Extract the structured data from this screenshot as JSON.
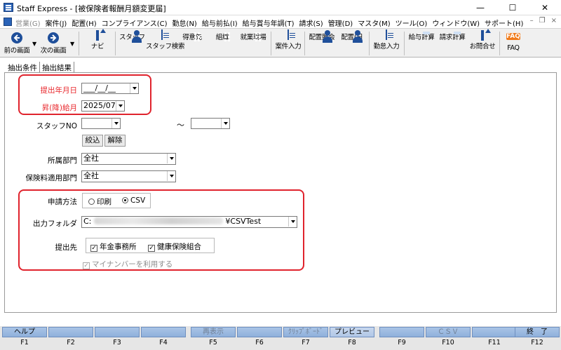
{
  "window": {
    "title": "Staff Express - [被保険者報酬月額変更届]",
    "controls": {
      "minimize": "—",
      "maximize": "☐",
      "close": "✕"
    }
  },
  "menubar": {
    "items": [
      {
        "label": "営業(G)",
        "disabled": true
      },
      {
        "label": "案件(J)"
      },
      {
        "label": "配置(H)"
      },
      {
        "label": "コンプライアンス(C)"
      },
      {
        "label": "勤怠(N)"
      },
      {
        "label": "給与前払(I)"
      },
      {
        "label": "給与賞与年調(T)"
      },
      {
        "label": "請求(S)"
      },
      {
        "label": "管理(D)"
      },
      {
        "label": "マスタ(M)"
      },
      {
        "label": "ツール(O)"
      },
      {
        "label": "ウィンドウ(W)"
      },
      {
        "label": "サポート(H)"
      }
    ],
    "mdi_controls": {
      "minimize": "–",
      "restore": "❐",
      "close": "×"
    }
  },
  "toolbar": {
    "back": "前の画面",
    "forward": "次の画面",
    "navi": "ナビ",
    "staff": "スタッフ",
    "staff_search": "スタッフ検索",
    "client": "得意先",
    "organization": "組織",
    "worksite": "就業現場",
    "case_entry": "案件入力",
    "placement_inquiry": "配置照会",
    "placement_day": "配置(日",
    "attendance_entry": "勤怠入力",
    "payroll_calc": "給与計算",
    "billing_calc": "請求計算",
    "inquiry": "お問合せ",
    "faq": "FAQ",
    "faq_icon_text": "FAQ"
  },
  "tabs": [
    "抽出条件",
    "抽出結果"
  ],
  "form": {
    "submission_date": {
      "label": "提出年月日",
      "value": "___/__/__",
      "color": "#e8252a"
    },
    "raise_month": {
      "label": "昇(降)給月",
      "value": "2025/07",
      "color": "#e8252a"
    },
    "staff_no": {
      "label": "スタッフNO",
      "from": "",
      "tilde": "～",
      "to": ""
    },
    "filter_button": "絞込",
    "clear_button": "解除",
    "department": {
      "label": "所属部門",
      "value": "全社"
    },
    "insurance_department": {
      "label": "保険料適用部門",
      "value": "全社"
    },
    "application_method": {
      "label": "申請方法",
      "options": [
        {
          "label": "印刷",
          "selected": false
        },
        {
          "label": "CSV",
          "selected": true
        }
      ]
    },
    "output_folder": {
      "label": "出力フォルダ",
      "prefix": "C:",
      "suffix": "¥CSVTest"
    },
    "submit_to": {
      "label": "提出先",
      "options": [
        {
          "label": "年金事務所",
          "checked": true
        },
        {
          "label": "健康保険組合",
          "checked": true
        }
      ]
    },
    "use_my_number": {
      "label": "マイナンバーを利用する",
      "checked": true,
      "disabled": true
    }
  },
  "fkeys": [
    {
      "key": "F1",
      "label": "ヘルプ"
    },
    {
      "key": "F2",
      "label": ""
    },
    {
      "key": "F3",
      "label": ""
    },
    {
      "key": "F4",
      "label": ""
    },
    {
      "key": "F5",
      "label": "再表示"
    },
    {
      "key": "F6",
      "label": ""
    },
    {
      "key": "F7",
      "label": "ｸﾘｯﾌﾟﾎﾞｰﾄﾞ"
    },
    {
      "key": "F8",
      "label": "プレビュー"
    },
    {
      "key": "F9",
      "label": ""
    },
    {
      "key": "F10",
      "label": "ＣＳＶ"
    },
    {
      "key": "F11",
      "label": ""
    },
    {
      "key": "F12",
      "label": "終　了"
    }
  ],
  "colors": {
    "accent": "#1f4f9a",
    "highlight_box": "#e0232d",
    "fkey": "#8fb0db"
  }
}
